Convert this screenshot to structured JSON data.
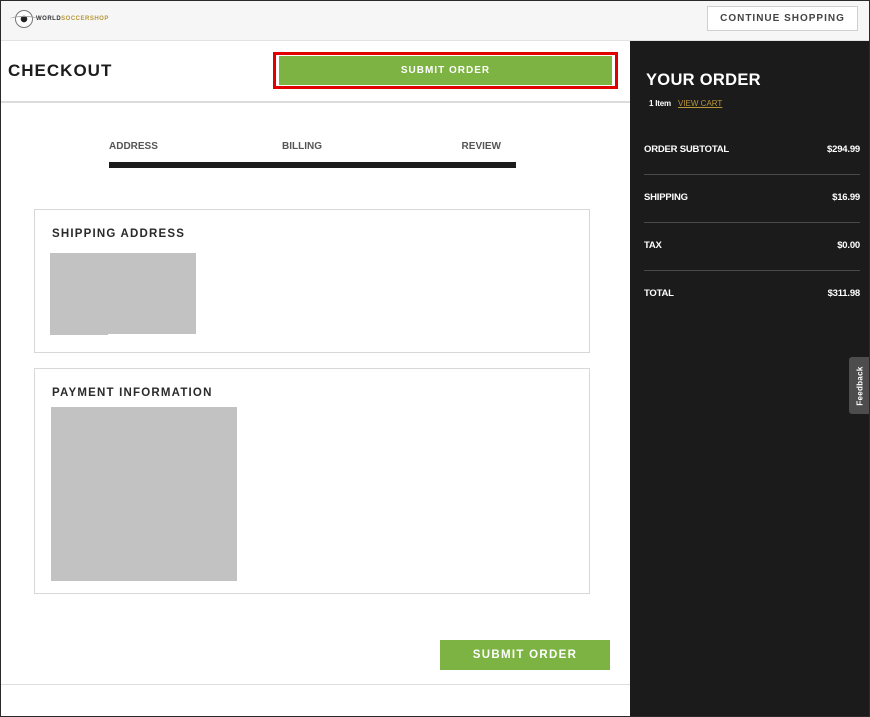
{
  "header": {
    "logo": {
      "prefix": "WORLD",
      "suffix": "SOCCERSHOP"
    },
    "continue_label": "CONTINUE SHOPPING"
  },
  "checkout": {
    "title": "CHECKOUT",
    "submit_top_label": "SUBMIT ORDER",
    "submit_bottom_label": "SUBMIT ORDER",
    "steps": [
      "ADDRESS",
      "BILLING",
      "REVIEW"
    ],
    "shipping_title": "SHIPPING ADDRESS",
    "payment_title": "PAYMENT INFORMATION"
  },
  "order": {
    "title": "YOUR ORDER",
    "item_count": "1 Item",
    "view_cart": "VIEW CART",
    "rows": [
      {
        "label": "ORDER SUBTOTAL",
        "value": "$294.99"
      },
      {
        "label": "SHIPPING",
        "value": "$16.99"
      },
      {
        "label": "TAX",
        "value": "$0.00"
      },
      {
        "label": "TOTAL",
        "value": "$311.98"
      }
    ]
  },
  "feedback_label": "Feedback",
  "colors": {
    "accent_green": "#7cb342",
    "sidebar_bg": "#1b1b1b",
    "highlight_red": "#e00000",
    "link_gold": "#b8963a"
  }
}
